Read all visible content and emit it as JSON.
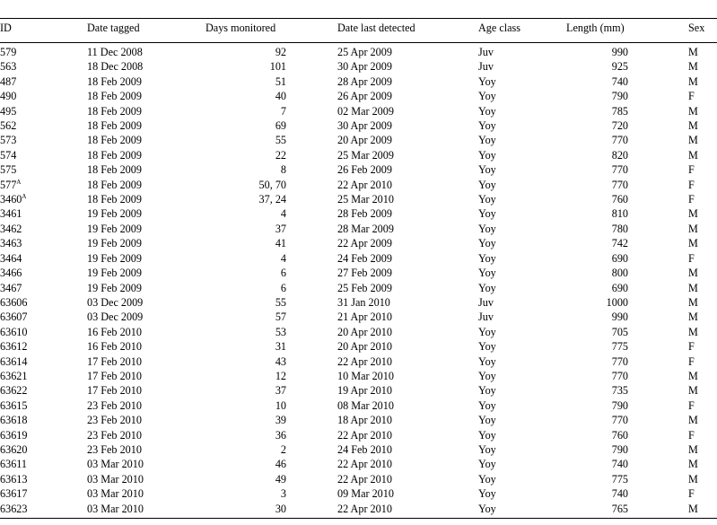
{
  "table": {
    "headers": {
      "id": "ID",
      "date_tagged": "Date tagged",
      "days_monitored": "Days monitored",
      "date_last_detected": "Date last detected",
      "age_class": "Age class",
      "length": "Length (mm)",
      "sex": "Sex"
    },
    "rows": [
      {
        "id": "579",
        "sup": "",
        "date_tagged": "11 Dec 2008",
        "days": "92",
        "last": "25 Apr 2009",
        "age": "Juv",
        "length": "990",
        "sex": "M"
      },
      {
        "id": "563",
        "sup": "",
        "date_tagged": "18 Dec 2008",
        "days": "101",
        "last": "30 Apr 2009",
        "age": "Juv",
        "length": "925",
        "sex": "M"
      },
      {
        "id": "487",
        "sup": "",
        "date_tagged": "18 Feb 2009",
        "days": "51",
        "last": "28 Apr 2009",
        "age": "Yoy",
        "length": "740",
        "sex": "M"
      },
      {
        "id": "490",
        "sup": "",
        "date_tagged": "18 Feb 2009",
        "days": "40",
        "last": "26 Apr 2009",
        "age": "Yoy",
        "length": "790",
        "sex": "F"
      },
      {
        "id": "495",
        "sup": "",
        "date_tagged": "18 Feb 2009",
        "days": "7",
        "last": "02 Mar 2009",
        "age": "Yoy",
        "length": "785",
        "sex": "M"
      },
      {
        "id": "562",
        "sup": "",
        "date_tagged": "18 Feb 2009",
        "days": "69",
        "last": "30 Apr 2009",
        "age": "Yoy",
        "length": "720",
        "sex": "M"
      },
      {
        "id": "573",
        "sup": "",
        "date_tagged": "18 Feb 2009",
        "days": "55",
        "last": "20 Apr 2009",
        "age": "Yoy",
        "length": "770",
        "sex": "M"
      },
      {
        "id": "574",
        "sup": "",
        "date_tagged": "18 Feb 2009",
        "days": "22",
        "last": "25 Mar 2009",
        "age": "Yoy",
        "length": "820",
        "sex": "M"
      },
      {
        "id": "575",
        "sup": "",
        "date_tagged": "18 Feb 2009",
        "days": "8",
        "last": "26 Feb 2009",
        "age": "Yoy",
        "length": "770",
        "sex": "F"
      },
      {
        "id": "577",
        "sup": "A",
        "date_tagged": "18 Feb 2009",
        "days": "50, 70",
        "last": "22 Apr 2010",
        "age": "Yoy",
        "length": "770",
        "sex": "F"
      },
      {
        "id": "3460",
        "sup": "A",
        "date_tagged": "18 Feb 2009",
        "days": "37, 24",
        "last": "25 Mar 2010",
        "age": "Yoy",
        "length": "760",
        "sex": "F"
      },
      {
        "id": "3461",
        "sup": "",
        "date_tagged": "19 Feb 2009",
        "days": "4",
        "last": "28 Feb 2009",
        "age": "Yoy",
        "length": "810",
        "sex": "M"
      },
      {
        "id": "3462",
        "sup": "",
        "date_tagged": "19 Feb 2009",
        "days": "37",
        "last": "28 Mar 2009",
        "age": "Yoy",
        "length": "780",
        "sex": "M"
      },
      {
        "id": "3463",
        "sup": "",
        "date_tagged": "19 Feb 2009",
        "days": "41",
        "last": "22 Apr 2009",
        "age": "Yoy",
        "length": "742",
        "sex": "M"
      },
      {
        "id": "3464",
        "sup": "",
        "date_tagged": "19 Feb 2009",
        "days": "4",
        "last": "24 Feb 2009",
        "age": "Yoy",
        "length": "690",
        "sex": "F"
      },
      {
        "id": "3466",
        "sup": "",
        "date_tagged": "19 Feb 2009",
        "days": "6",
        "last": "27 Feb 2009",
        "age": "Yoy",
        "length": "800",
        "sex": "M"
      },
      {
        "id": "3467",
        "sup": "",
        "date_tagged": "19 Feb 2009",
        "days": "6",
        "last": "25 Feb 2009",
        "age": "Yoy",
        "length": "690",
        "sex": "M"
      },
      {
        "id": "63606",
        "sup": "",
        "date_tagged": "03 Dec 2009",
        "days": "55",
        "last": "31 Jan 2010",
        "age": "Juv",
        "length": "1000",
        "sex": "M"
      },
      {
        "id": "63607",
        "sup": "",
        "date_tagged": "03 Dec 2009",
        "days": "57",
        "last": "21 Apr 2010",
        "age": "Juv",
        "length": "990",
        "sex": "M"
      },
      {
        "id": "63610",
        "sup": "",
        "date_tagged": "16 Feb 2010",
        "days": "53",
        "last": "20 Apr 2010",
        "age": "Yoy",
        "length": "705",
        "sex": "M"
      },
      {
        "id": "63612",
        "sup": "",
        "date_tagged": "16 Feb 2010",
        "days": "31",
        "last": "20 Apr 2010",
        "age": "Yoy",
        "length": "775",
        "sex": "F"
      },
      {
        "id": "63614",
        "sup": "",
        "date_tagged": "17 Feb 2010",
        "days": "43",
        "last": "22 Apr 2010",
        "age": "Yoy",
        "length": "770",
        "sex": "F"
      },
      {
        "id": "63621",
        "sup": "",
        "date_tagged": "17 Feb 2010",
        "days": "12",
        "last": "10 Mar 2010",
        "age": "Yoy",
        "length": "770",
        "sex": "M"
      },
      {
        "id": "63622",
        "sup": "",
        "date_tagged": "17 Feb 2010",
        "days": "37",
        "last": "19 Apr 2010",
        "age": "Yoy",
        "length": "735",
        "sex": "M"
      },
      {
        "id": "63615",
        "sup": "",
        "date_tagged": "23 Feb 2010",
        "days": "10",
        "last": "08 Mar 2010",
        "age": "Yoy",
        "length": "790",
        "sex": "F"
      },
      {
        "id": "63618",
        "sup": "",
        "date_tagged": "23 Feb 2010",
        "days": "39",
        "last": "18 Apr 2010",
        "age": "Yoy",
        "length": "770",
        "sex": "M"
      },
      {
        "id": "63619",
        "sup": "",
        "date_tagged": "23 Feb 2010",
        "days": "36",
        "last": "22 Apr 2010",
        "age": "Yoy",
        "length": "760",
        "sex": "F"
      },
      {
        "id": "63620",
        "sup": "",
        "date_tagged": "23 Feb 2010",
        "days": "2",
        "last": "24 Feb 2010",
        "age": "Yoy",
        "length": "790",
        "sex": "M"
      },
      {
        "id": "63611",
        "sup": "",
        "date_tagged": "03 Mar 2010",
        "days": "46",
        "last": "22 Apr 2010",
        "age": "Yoy",
        "length": "740",
        "sex": "M"
      },
      {
        "id": "63613",
        "sup": "",
        "date_tagged": "03 Mar 2010",
        "days": "49",
        "last": "22 Apr 2010",
        "age": "Yoy",
        "length": "775",
        "sex": "M"
      },
      {
        "id": "63617",
        "sup": "",
        "date_tagged": "03 Mar 2010",
        "days": "3",
        "last": "09 Mar 2010",
        "age": "Yoy",
        "length": "740",
        "sex": "F"
      },
      {
        "id": "63623",
        "sup": "",
        "date_tagged": "03 Mar 2010",
        "days": "30",
        "last": "22 Apr 2010",
        "age": "Yoy",
        "length": "765",
        "sex": "M"
      }
    ]
  }
}
